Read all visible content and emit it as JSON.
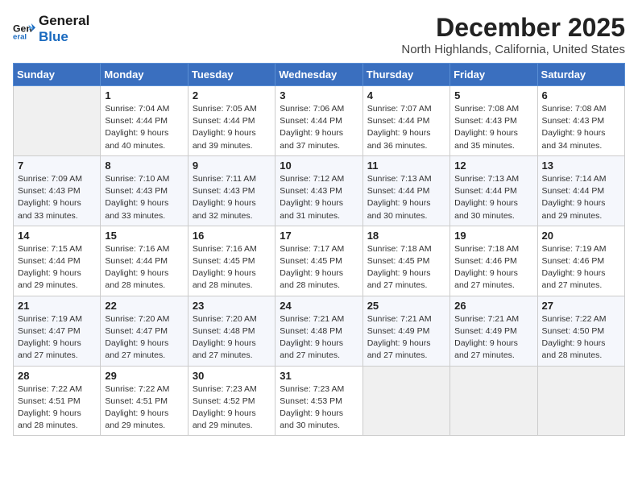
{
  "logo": {
    "line1": "General",
    "line2": "Blue"
  },
  "title": "December 2025",
  "subtitle": "North Highlands, California, United States",
  "weekdays": [
    "Sunday",
    "Monday",
    "Tuesday",
    "Wednesday",
    "Thursday",
    "Friday",
    "Saturday"
  ],
  "weeks": [
    [
      {
        "day": "",
        "info": ""
      },
      {
        "day": "1",
        "info": "Sunrise: 7:04 AM\nSunset: 4:44 PM\nDaylight: 9 hours\nand 40 minutes."
      },
      {
        "day": "2",
        "info": "Sunrise: 7:05 AM\nSunset: 4:44 PM\nDaylight: 9 hours\nand 39 minutes."
      },
      {
        "day": "3",
        "info": "Sunrise: 7:06 AM\nSunset: 4:44 PM\nDaylight: 9 hours\nand 37 minutes."
      },
      {
        "day": "4",
        "info": "Sunrise: 7:07 AM\nSunset: 4:44 PM\nDaylight: 9 hours\nand 36 minutes."
      },
      {
        "day": "5",
        "info": "Sunrise: 7:08 AM\nSunset: 4:43 PM\nDaylight: 9 hours\nand 35 minutes."
      },
      {
        "day": "6",
        "info": "Sunrise: 7:08 AM\nSunset: 4:43 PM\nDaylight: 9 hours\nand 34 minutes."
      }
    ],
    [
      {
        "day": "7",
        "info": "Sunrise: 7:09 AM\nSunset: 4:43 PM\nDaylight: 9 hours\nand 33 minutes."
      },
      {
        "day": "8",
        "info": "Sunrise: 7:10 AM\nSunset: 4:43 PM\nDaylight: 9 hours\nand 33 minutes."
      },
      {
        "day": "9",
        "info": "Sunrise: 7:11 AM\nSunset: 4:43 PM\nDaylight: 9 hours\nand 32 minutes."
      },
      {
        "day": "10",
        "info": "Sunrise: 7:12 AM\nSunset: 4:43 PM\nDaylight: 9 hours\nand 31 minutes."
      },
      {
        "day": "11",
        "info": "Sunrise: 7:13 AM\nSunset: 4:44 PM\nDaylight: 9 hours\nand 30 minutes."
      },
      {
        "day": "12",
        "info": "Sunrise: 7:13 AM\nSunset: 4:44 PM\nDaylight: 9 hours\nand 30 minutes."
      },
      {
        "day": "13",
        "info": "Sunrise: 7:14 AM\nSunset: 4:44 PM\nDaylight: 9 hours\nand 29 minutes."
      }
    ],
    [
      {
        "day": "14",
        "info": "Sunrise: 7:15 AM\nSunset: 4:44 PM\nDaylight: 9 hours\nand 29 minutes."
      },
      {
        "day": "15",
        "info": "Sunrise: 7:16 AM\nSunset: 4:44 PM\nDaylight: 9 hours\nand 28 minutes."
      },
      {
        "day": "16",
        "info": "Sunrise: 7:16 AM\nSunset: 4:45 PM\nDaylight: 9 hours\nand 28 minutes."
      },
      {
        "day": "17",
        "info": "Sunrise: 7:17 AM\nSunset: 4:45 PM\nDaylight: 9 hours\nand 28 minutes."
      },
      {
        "day": "18",
        "info": "Sunrise: 7:18 AM\nSunset: 4:45 PM\nDaylight: 9 hours\nand 27 minutes."
      },
      {
        "day": "19",
        "info": "Sunrise: 7:18 AM\nSunset: 4:46 PM\nDaylight: 9 hours\nand 27 minutes."
      },
      {
        "day": "20",
        "info": "Sunrise: 7:19 AM\nSunset: 4:46 PM\nDaylight: 9 hours\nand 27 minutes."
      }
    ],
    [
      {
        "day": "21",
        "info": "Sunrise: 7:19 AM\nSunset: 4:47 PM\nDaylight: 9 hours\nand 27 minutes."
      },
      {
        "day": "22",
        "info": "Sunrise: 7:20 AM\nSunset: 4:47 PM\nDaylight: 9 hours\nand 27 minutes."
      },
      {
        "day": "23",
        "info": "Sunrise: 7:20 AM\nSunset: 4:48 PM\nDaylight: 9 hours\nand 27 minutes."
      },
      {
        "day": "24",
        "info": "Sunrise: 7:21 AM\nSunset: 4:48 PM\nDaylight: 9 hours\nand 27 minutes."
      },
      {
        "day": "25",
        "info": "Sunrise: 7:21 AM\nSunset: 4:49 PM\nDaylight: 9 hours\nand 27 minutes."
      },
      {
        "day": "26",
        "info": "Sunrise: 7:21 AM\nSunset: 4:49 PM\nDaylight: 9 hours\nand 27 minutes."
      },
      {
        "day": "27",
        "info": "Sunrise: 7:22 AM\nSunset: 4:50 PM\nDaylight: 9 hours\nand 28 minutes."
      }
    ],
    [
      {
        "day": "28",
        "info": "Sunrise: 7:22 AM\nSunset: 4:51 PM\nDaylight: 9 hours\nand 28 minutes."
      },
      {
        "day": "29",
        "info": "Sunrise: 7:22 AM\nSunset: 4:51 PM\nDaylight: 9 hours\nand 29 minutes."
      },
      {
        "day": "30",
        "info": "Sunrise: 7:23 AM\nSunset: 4:52 PM\nDaylight: 9 hours\nand 29 minutes."
      },
      {
        "day": "31",
        "info": "Sunrise: 7:23 AM\nSunset: 4:53 PM\nDaylight: 9 hours\nand 30 minutes."
      },
      {
        "day": "",
        "info": ""
      },
      {
        "day": "",
        "info": ""
      },
      {
        "day": "",
        "info": ""
      }
    ]
  ]
}
